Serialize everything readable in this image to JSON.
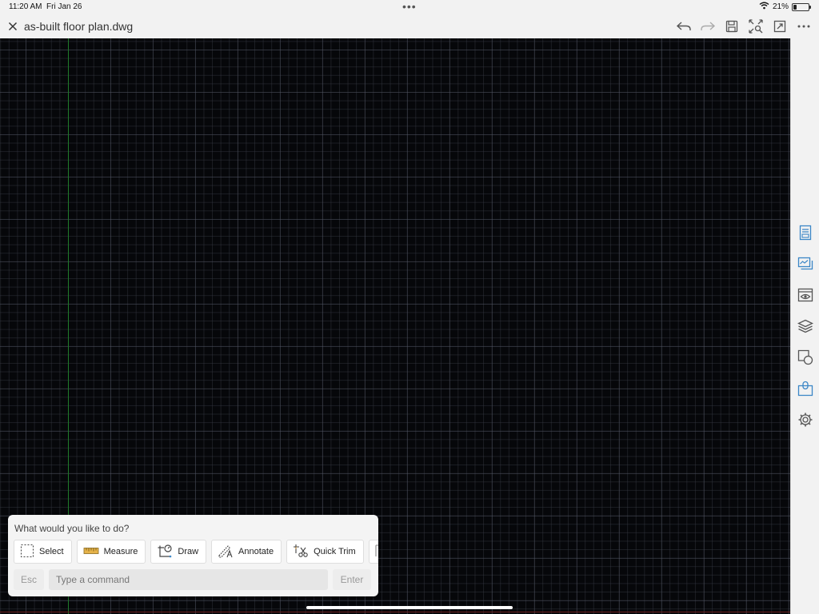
{
  "status_bar": {
    "time": "11:20 AM",
    "date": "Fri Jan 26",
    "dots": "•••",
    "battery_percent": "21%",
    "battery_level": 0.21
  },
  "title_bar": {
    "document_title": "as-built floor plan.dwg",
    "icons": [
      "close-icon",
      "undo-icon",
      "redo-icon",
      "save-icon",
      "zoom-extents-icon",
      "fullscreen-icon",
      "more-icon"
    ]
  },
  "sidebar": {
    "items": [
      {
        "icon": "sheet-icon"
      },
      {
        "icon": "layout-icon"
      },
      {
        "icon": "view-icon"
      },
      {
        "icon": "layers-icon"
      },
      {
        "icon": "blocks-icon"
      },
      {
        "icon": "clipboard-icon"
      },
      {
        "icon": "settings-icon"
      }
    ]
  },
  "command_panel": {
    "prompt": "What would you like to do?",
    "tools": [
      {
        "label": "Select",
        "icon": "select-icon"
      },
      {
        "label": "Measure",
        "icon": "ruler-icon"
      },
      {
        "label": "Draw",
        "icon": "draw-icon"
      },
      {
        "label": "Annotate",
        "icon": "annotate-icon"
      },
      {
        "label": "Quick Trim",
        "icon": "scissors-icon"
      }
    ],
    "esc_label": "Esc",
    "input_placeholder": "Type a command",
    "input_value": "",
    "enter_label": "Enter"
  },
  "colors": {
    "canvas_background": "#06070a",
    "y_axis": "#1f7a2a",
    "x_axis": "#6a1d1d",
    "accent": "#2a7fc1"
  }
}
